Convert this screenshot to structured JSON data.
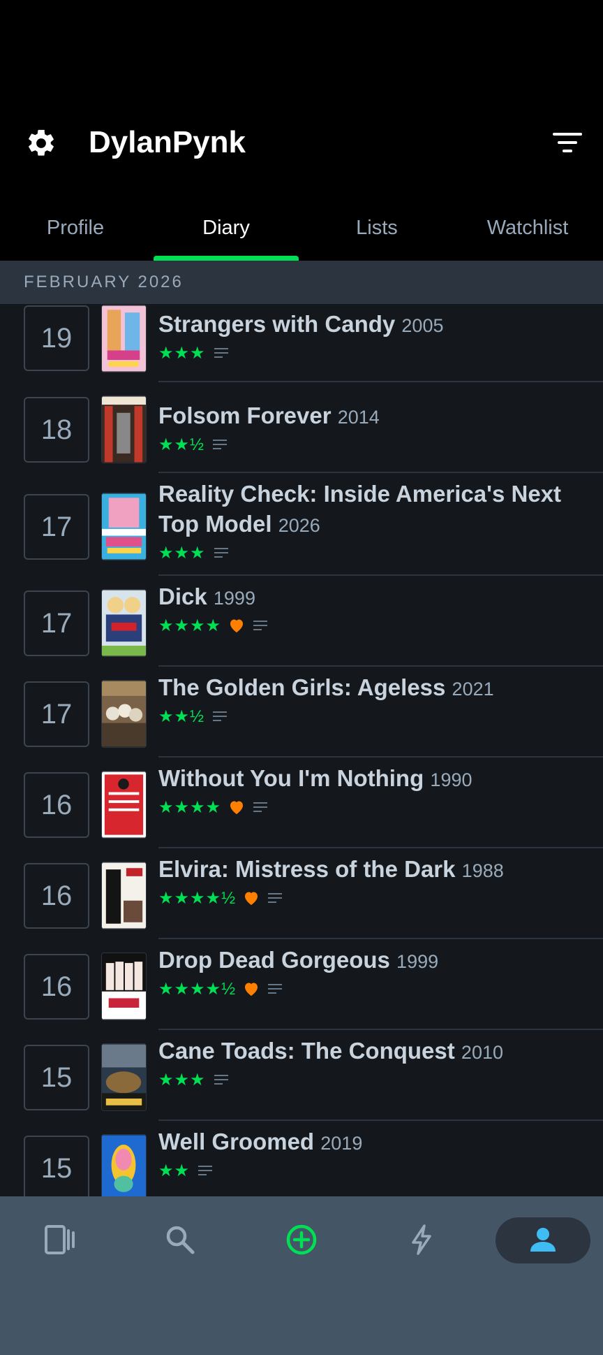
{
  "header": {
    "username": "DylanPynk",
    "settings_icon": "gear-icon",
    "filter_icon": "filter-icon"
  },
  "tabs": [
    {
      "label": "Profile",
      "active": false
    },
    {
      "label": "Diary",
      "active": true
    },
    {
      "label": "Lists",
      "active": false
    },
    {
      "label": "Watchlist",
      "active": false
    }
  ],
  "month": "FEBRUARY 2026",
  "entries": [
    {
      "day": "19",
      "title": "Strangers with Candy",
      "year": "2005",
      "stars": "★★★",
      "liked": false,
      "review": true
    },
    {
      "day": "18",
      "title": "Folsom Forever",
      "year": "2014",
      "stars": "★★½",
      "liked": false,
      "review": true
    },
    {
      "day": "17",
      "title": "Reality Check: Inside America's Next Top Model",
      "year": "2026",
      "stars": "★★★",
      "liked": false,
      "review": true
    },
    {
      "day": "17",
      "title": "Dick",
      "year": "1999",
      "stars": "★★★★",
      "liked": true,
      "review": true
    },
    {
      "day": "17",
      "title": "The Golden Girls: Ageless",
      "year": "2021",
      "stars": "★★½",
      "liked": false,
      "review": true
    },
    {
      "day": "16",
      "title": "Without You I'm Nothing",
      "year": "1990",
      "stars": "★★★★",
      "liked": true,
      "review": true
    },
    {
      "day": "16",
      "title": "Elvira: Mistress of the Dark",
      "year": "1988",
      "stars": "★★★★½",
      "liked": true,
      "review": true
    },
    {
      "day": "16",
      "title": "Drop Dead Gorgeous",
      "year": "1999",
      "stars": "★★★★½",
      "liked": true,
      "review": true
    },
    {
      "day": "15",
      "title": "Cane Toads: The Conquest",
      "year": "2010",
      "stars": "★★★",
      "liked": false,
      "review": true
    },
    {
      "day": "15",
      "title": "Well Groomed",
      "year": "2019",
      "stars": "★★",
      "liked": false,
      "review": true
    }
  ],
  "bottom_nav": [
    {
      "icon": "films-icon",
      "active": false
    },
    {
      "icon": "search-icon",
      "active": false
    },
    {
      "icon": "add-icon",
      "active": false
    },
    {
      "icon": "activity-icon",
      "active": false
    },
    {
      "icon": "profile-icon",
      "active": true
    }
  ],
  "colors": {
    "accent_green": "#00e054",
    "like_orange": "#ff8000",
    "active_blue": "#40bcf4",
    "background": "#14181c"
  }
}
